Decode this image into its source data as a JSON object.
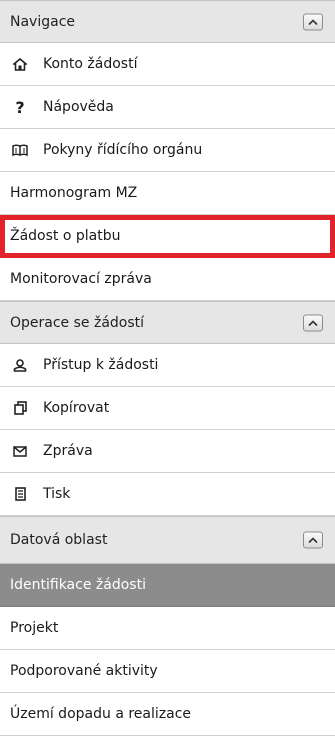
{
  "sections": {
    "navigace": {
      "title": "Navigace",
      "items": [
        {
          "label": "Konto žádostí",
          "icon": "home-icon"
        },
        {
          "label": "Nápověda",
          "icon": "question-icon"
        },
        {
          "label": "Pokyny řídícího orgánu",
          "icon": "book-icon"
        },
        {
          "label": "Harmonogram MZ"
        },
        {
          "label": "Žádost o platbu"
        },
        {
          "label": "Monitorovací zpráva"
        }
      ]
    },
    "operace": {
      "title": "Operace se žádostí",
      "items": [
        {
          "label": "Přístup k žádosti",
          "icon": "user-icon"
        },
        {
          "label": "Kopírovat",
          "icon": "copy-icon"
        },
        {
          "label": "Zpráva",
          "icon": "envelope-icon"
        },
        {
          "label": "Tisk",
          "icon": "print-icon"
        }
      ]
    },
    "datova": {
      "title": "Datová oblast",
      "items": [
        {
          "label": "Identifikace žádosti",
          "active": true
        },
        {
          "label": "Projekt"
        },
        {
          "label": "Podporované aktivity"
        },
        {
          "label": "Území dopadu a realizace"
        }
      ]
    }
  },
  "colors": {
    "header_bg": "#e6e6e6",
    "active_bg": "#8c8c8c",
    "highlight_border": "#e2232c"
  }
}
